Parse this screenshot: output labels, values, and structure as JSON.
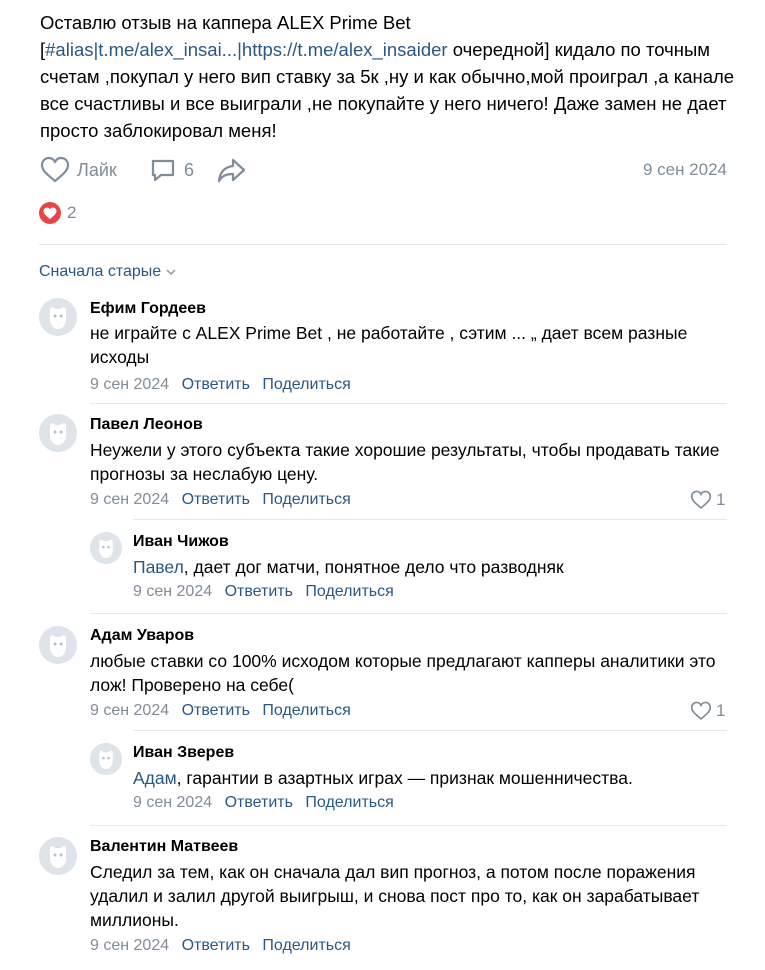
{
  "post": {
    "text_part1": "Оставлю отзыв на каппера ALEX Prime Bet  [",
    "link_alias": "#alias|t.me/alex_insai...|https://t.me/alex_insaider",
    "text_part2": "  очередной] кидало по точным счетам ,покупал у него вип ставку за 5к ,ну и как обычно,мой проиграл ,а канале все счастливы и все выиграли ,не покупайте у него ничего! Даже замен не дает просто заблокировал меня!",
    "like_label": "Лайк",
    "comments_count": "6",
    "date": "9 сен 2024",
    "reactions_count": "2"
  },
  "sort_label": "Сначала старые",
  "actions": {
    "reply": "Ответить",
    "share": "Поделиться"
  },
  "comments": [
    {
      "author": "Ефим Гордеев",
      "text": "не играйте с ALEX Prime Bet , не работайте , сэтим ... „ дает всем разные исходы",
      "date": "9 сен 2024"
    },
    {
      "author": "Павел Леонов",
      "text": "Неужели у этого субъекта такие хорошие результаты, чтобы продавать такие прогнозы за неслабую цену.",
      "date": "9 сен 2024",
      "likes": "1"
    },
    {
      "author": "Иван Чижов",
      "mention": "Павел",
      "text": ", дает дог матчи, понятное дело что разводняк",
      "date": "9 сен 2024"
    },
    {
      "author": "Адам Уваров",
      "text": "любые ставки со 100% исходом которые предлагают капперы аналитики это лож! Проверено на себе(",
      "date": "9 сен 2024",
      "likes": "1"
    },
    {
      "author": "Иван Зверев",
      "mention": "Адам",
      "text": ", гарантии в азартных играх — признак мошенничества.",
      "date": "9 сен 2024"
    },
    {
      "author": "Валентин Матвеев",
      "text": "Следил за тем, как он сначала дал вип прогноз, а потом после поражения удалил и залил другой выигрыш, и снова пост про то, как он зарабатывает миллионы.",
      "date": "9 сен 2024"
    }
  ],
  "colors": {
    "link": "#2a5885",
    "muted": "#818c99",
    "reaction": "#e64646",
    "divider": "#e7e8ec"
  }
}
